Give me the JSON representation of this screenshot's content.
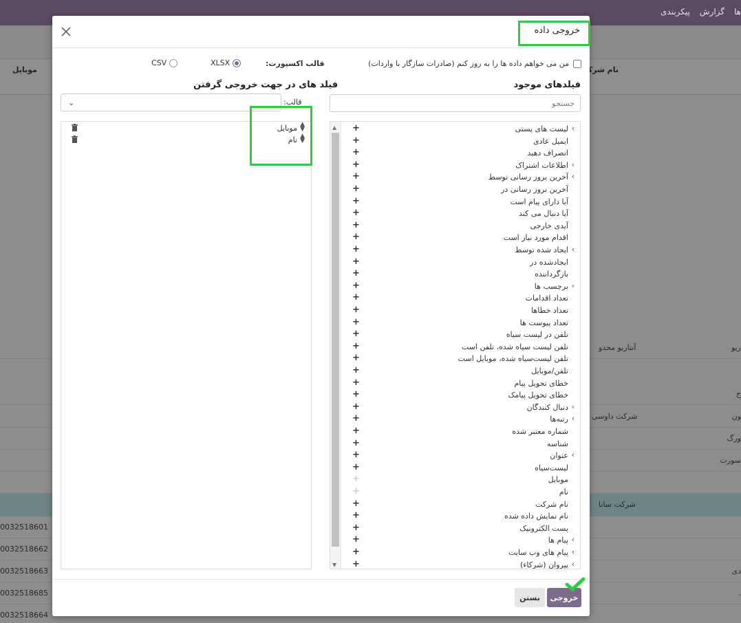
{
  "background": {
    "navbar_items": [
      "پیکربندی",
      "گزارش",
      "ها"
    ],
    "columns": {
      "company": "نام شرکت",
      "mobile": "موبایل"
    },
    "rows": [
      {
        "company": "آنتاریو محدو",
        "name": "ریو"
      },
      {
        "company": "",
        "name": "ج"
      },
      {
        "company": "شرکت داوسی",
        "name": "ون"
      },
      {
        "company": "",
        "name": "ورگ"
      },
      {
        "company": "",
        "name": "سورت"
      }
    ],
    "group_label": "شرکت سانا",
    "mobiles": [
      "0032518601",
      "0032518662",
      "0032518663",
      "0032518685",
      "0032518664"
    ],
    "side_fragments": [
      "دی",
      "."
    ]
  },
  "modal": {
    "title": "خروجی داده",
    "update_checkbox_label": "من می خواهم داده ها را به روز کنم (صادرات سازگار با واردات)",
    "format_label": "قالب اکسپورت:",
    "formats": [
      "XLSX",
      "CSV"
    ],
    "selected_format": "XLSX",
    "available_title": "فیلدهای موجود",
    "search_placeholder": "جستجو",
    "export_title": "فیلد های در جهت خروجی گرفتن",
    "template_label": "قالب:",
    "available_fields": [
      {
        "label": "لیست های پستی",
        "expandable": true,
        "disabled": false
      },
      {
        "label": "ایمیل عادی",
        "expandable": false,
        "disabled": false
      },
      {
        "label": "انصراف دهید",
        "expandable": false,
        "disabled": false
      },
      {
        "label": "اطلاعات اشتراک",
        "expandable": true,
        "disabled": false
      },
      {
        "label": "آخرین بروز رسانی توسط",
        "expandable": true,
        "disabled": false
      },
      {
        "label": "آخرین بروز رسانی در",
        "expandable": false,
        "disabled": false
      },
      {
        "label": "آیا دارای پیام است",
        "expandable": false,
        "disabled": false
      },
      {
        "label": "آیا دنبال می کند",
        "expandable": false,
        "disabled": false
      },
      {
        "label": "آیدی خارجی",
        "expandable": false,
        "disabled": false
      },
      {
        "label": "اقدام مورد نیاز است",
        "expandable": false,
        "disabled": false
      },
      {
        "label": "ایجاد شده توسط",
        "expandable": true,
        "disabled": false
      },
      {
        "label": "ایجادشده در",
        "expandable": false,
        "disabled": false
      },
      {
        "label": "بازگرداننده",
        "expandable": false,
        "disabled": false
      },
      {
        "label": "برچسب ها",
        "expandable": true,
        "disabled": false
      },
      {
        "label": "تعداد اقدامات",
        "expandable": false,
        "disabled": false
      },
      {
        "label": "تعداد خطاها",
        "expandable": false,
        "disabled": false
      },
      {
        "label": "تعداد پیوست ها",
        "expandable": false,
        "disabled": false
      },
      {
        "label": "تلفن در لیست سیاه",
        "expandable": false,
        "disabled": false
      },
      {
        "label": "تلفن لیست سیاه شده، تلفن است",
        "expandable": false,
        "disabled": false
      },
      {
        "label": "تلفن لیست‌سیاه شده، موبایل است",
        "expandable": false,
        "disabled": false
      },
      {
        "label": "تلفن/موبایل",
        "expandable": false,
        "disabled": false
      },
      {
        "label": "خطای تحویل پیام",
        "expandable": false,
        "disabled": false
      },
      {
        "label": "خطای تحویل پیامک",
        "expandable": false,
        "disabled": false
      },
      {
        "label": "دنبال کنندگان",
        "expandable": true,
        "disabled": false
      },
      {
        "label": "رتبه‌ها",
        "expandable": true,
        "disabled": false
      },
      {
        "label": "شماره معتبر شده",
        "expandable": false,
        "disabled": false
      },
      {
        "label": "شناسه",
        "expandable": false,
        "disabled": false
      },
      {
        "label": "عنوان",
        "expandable": true,
        "disabled": false
      },
      {
        "label": "لیست‌سیاه",
        "expandable": false,
        "disabled": false
      },
      {
        "label": "موبایل",
        "expandable": false,
        "disabled": true
      },
      {
        "label": "نام",
        "expandable": false,
        "disabled": true
      },
      {
        "label": "نام شرکت",
        "expandable": false,
        "disabled": false
      },
      {
        "label": "نام نمایش داده شده",
        "expandable": false,
        "disabled": false
      },
      {
        "label": "پست الکترونیک",
        "expandable": false,
        "disabled": false
      },
      {
        "label": "پیام ها",
        "expandable": true,
        "disabled": false
      },
      {
        "label": "پیام های وب سایت",
        "expandable": true,
        "disabled": false
      },
      {
        "label": "پیروان (شرکاء)",
        "expandable": true,
        "disabled": false
      }
    ],
    "export_fields": [
      "موبایل",
      "نام"
    ],
    "buttons": {
      "export": "خروجی",
      "close": "بستن"
    },
    "colors": {
      "primary": "#7c6b8b",
      "highlight": "#2ecc40"
    }
  }
}
